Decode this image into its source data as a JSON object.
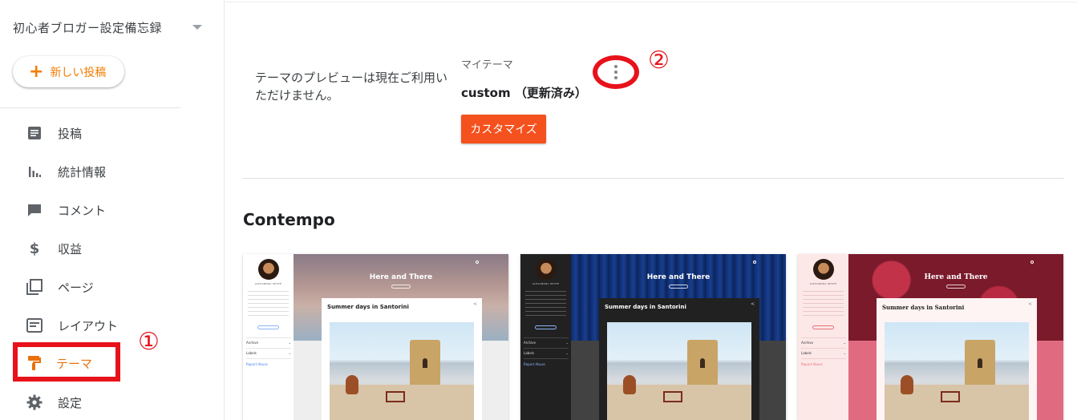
{
  "sidebar": {
    "blog_name": "初心者ブロガー設定備忘録",
    "new_post_label": "新しい投稿",
    "items": [
      {
        "label": "投稿",
        "icon": "posts-icon"
      },
      {
        "label": "統計情報",
        "icon": "stats-icon"
      },
      {
        "label": "コメント",
        "icon": "comment-icon"
      },
      {
        "label": "収益",
        "icon": "dollar-icon"
      },
      {
        "label": "ページ",
        "icon": "pages-icon"
      },
      {
        "label": "レイアウト",
        "icon": "layout-icon"
      },
      {
        "label": "テーマ",
        "icon": "theme-paint-roller-icon",
        "active": true
      },
      {
        "label": "設定",
        "icon": "gear-icon"
      }
    ]
  },
  "annotations": {
    "marker1": "①",
    "marker2": "②"
  },
  "main": {
    "preview_unavailable": "テーマのプレビューは現在ご利用いただけません。",
    "my_theme_label": "マイテーマ",
    "current_theme": "custom （更新済み）",
    "customize_label": "カスタマイズ",
    "section_title": "Contempo"
  },
  "theme_cards": [
    {
      "variant": "light",
      "hero_title": "Here and There",
      "post_title": "Summer days in Santorini",
      "author": "ALEXANDRA WHITE",
      "archive": "Archive",
      "labels": "Labels",
      "report_abuse": "Report Abuse"
    },
    {
      "variant": "dark",
      "hero_title": "Here and There",
      "post_title": "Summer days in Santorini",
      "author": "ALEXANDRA WHITE",
      "archive": "Archive",
      "labels": "Labels",
      "report_abuse": "Report Abuse"
    },
    {
      "variant": "pink",
      "hero_title": "Here and There",
      "post_title": "Summer days in Santorini",
      "author": "ALEXANDRA WHITE",
      "archive": "Archive",
      "labels": "Labels",
      "report_abuse": "Report Abuse"
    }
  ],
  "colors": {
    "accent": "#e8710a",
    "customize_button": "#f4511e",
    "annotation_red": "#e8121b"
  }
}
